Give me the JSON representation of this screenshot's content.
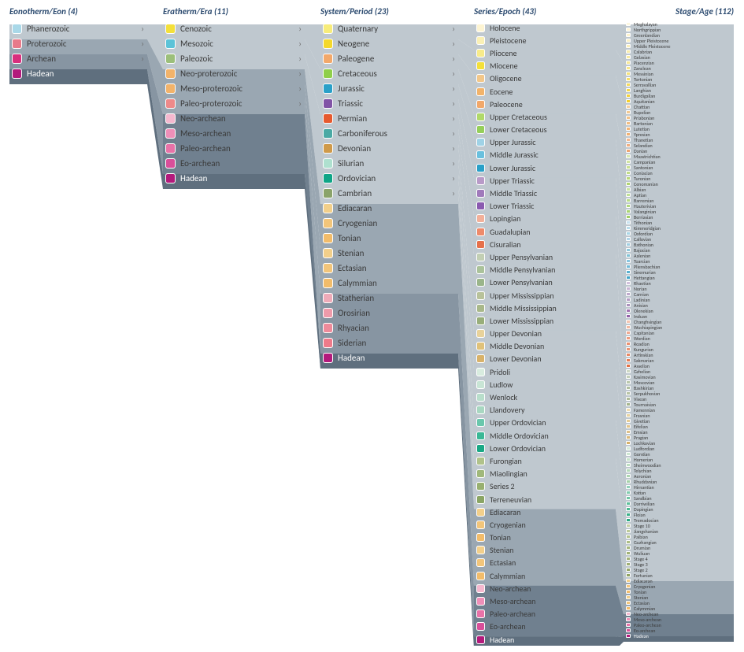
{
  "columns": [
    {
      "header": "Eonotherm/Eon (4)",
      "items": [
        {
          "label": "Phanerozoic",
          "color": "#a9d8e8",
          "expand": true
        },
        {
          "label": "Proterozoic",
          "color": "#e87a8a",
          "expand": true
        },
        {
          "label": "Archean",
          "color": "#d92f7e",
          "expand": true
        },
        {
          "label": "Hadean",
          "color": "#b31a7c",
          "expand": false,
          "selected": true
        }
      ]
    },
    {
      "header": "Eratherm/Era (11)",
      "items": [
        {
          "label": "Cenozoic",
          "color": "#f4e03a",
          "expand": true
        },
        {
          "label": "Mesozoic",
          "color": "#5cc3d8",
          "expand": true
        },
        {
          "label": "Paleozoic",
          "color": "#9cbf7a",
          "expand": true
        },
        {
          "label": "Neo-proterozoic",
          "color": "#f2b36a",
          "expand": true
        },
        {
          "label": "Meso-proterozoic",
          "color": "#f2b36a",
          "expand": true
        },
        {
          "label": "Paleo-proterozoic",
          "color": "#ee8a8a",
          "expand": true
        },
        {
          "label": "Neo-archean",
          "color": "#f4b8cf",
          "expand": false
        },
        {
          "label": "Meso-archean",
          "color": "#ee8fb8",
          "expand": false
        },
        {
          "label": "Paleo-archean",
          "color": "#e872a8",
          "expand": false
        },
        {
          "label": "Eo-archean",
          "color": "#d94f9a",
          "expand": false
        },
        {
          "label": "Hadean",
          "color": "#b31a7c",
          "expand": false,
          "selected": true
        }
      ]
    },
    {
      "header": "System/Period (23)",
      "items": [
        {
          "label": "Quaternary",
          "color": "#f7ec7a",
          "expand": true
        },
        {
          "label": "Neogene",
          "color": "#f4d82a",
          "expand": true
        },
        {
          "label": "Paleogene",
          "color": "#f2a86a",
          "expand": true
        },
        {
          "label": "Cretaceous",
          "color": "#8fcf4a",
          "expand": true
        },
        {
          "label": "Jurassic",
          "color": "#2aa0c8",
          "expand": true
        },
        {
          "label": "Triassic",
          "color": "#8153a6",
          "expand": true
        },
        {
          "label": "Permian",
          "color": "#e65a2f",
          "expand": true
        },
        {
          "label": "Carboniferous",
          "color": "#4aa9a4",
          "expand": true
        },
        {
          "label": "Devonian",
          "color": "#cf9a4a",
          "expand": true
        },
        {
          "label": "Silurian",
          "color": "#aee0cf",
          "expand": true
        },
        {
          "label": "Ordovician",
          "color": "#0fa587",
          "expand": true
        },
        {
          "label": "Cambrian",
          "color": "#8aa36a",
          "expand": true
        },
        {
          "label": "Ediacaran",
          "color": "#f2cf8a",
          "expand": false
        },
        {
          "label": "Cryogenian",
          "color": "#f2c57a",
          "expand": false
        },
        {
          "label": "Tonian",
          "color": "#f2bc6a",
          "expand": false
        },
        {
          "label": "Stenian",
          "color": "#f2cf8a",
          "expand": false
        },
        {
          "label": "Ectasian",
          "color": "#f2c57a",
          "expand": false
        },
        {
          "label": "Calymmian",
          "color": "#f2bc6a",
          "expand": false
        },
        {
          "label": "Statherian",
          "color": "#eeaab8",
          "expand": false
        },
        {
          "label": "Orosirian",
          "color": "#ee9aaa",
          "expand": false
        },
        {
          "label": "Rhyacian",
          "color": "#ee8a9a",
          "expand": false
        },
        {
          "label": "Siderian",
          "color": "#ee7a8a",
          "expand": false
        },
        {
          "label": "Hadean",
          "color": "#b31a7c",
          "expand": false,
          "selected": true
        }
      ]
    },
    {
      "header": "Series/Epoch (43)",
      "items": [
        {
          "label": "Holocene",
          "color": "#fdf4d2"
        },
        {
          "label": "Pleistocene",
          "color": "#faf0b5"
        },
        {
          "label": "Pliocene",
          "color": "#f7eb8a"
        },
        {
          "label": "Miocene",
          "color": "#f4e03a"
        },
        {
          "label": "Oligocene",
          "color": "#f2c78a"
        },
        {
          "label": "Eocene",
          "color": "#f2b36a"
        },
        {
          "label": "Paleocene",
          "color": "#f2a86a"
        },
        {
          "label": "Upper Cretaceous",
          "color": "#b0d96a"
        },
        {
          "label": "Lower Cretaceous",
          "color": "#95cf5a"
        },
        {
          "label": "Upper Jurassic",
          "color": "#9fd2e6"
        },
        {
          "label": "Middle Jurassic",
          "color": "#6ac0de"
        },
        {
          "label": "Lower Jurassic",
          "color": "#2aa0c8"
        },
        {
          "label": "Upper Triassic",
          "color": "#b89ac8"
        },
        {
          "label": "Middle Triassic",
          "color": "#a07abb"
        },
        {
          "label": "Lower Triassic",
          "color": "#8a5ab0"
        },
        {
          "label": "Lopingian",
          "color": "#f2b09a"
        },
        {
          "label": "Guadalupian",
          "color": "#ee8a6a"
        },
        {
          "label": "Cisuralian",
          "color": "#e6704a"
        },
        {
          "label": "Upper Pensylvanian",
          "color": "#c2cfb4"
        },
        {
          "label": "Middle Pensylvanian",
          "color": "#aac29a"
        },
        {
          "label": "Lower Pensylvanian",
          "color": "#9ab58a"
        },
        {
          "label": "Upper Mississippian",
          "color": "#b8c29a"
        },
        {
          "label": "Middle Mississippian",
          "color": "#a8b88a"
        },
        {
          "label": "Lower Mississippian",
          "color": "#98ae7a"
        },
        {
          "label": "Upper Devonian",
          "color": "#e8d29a"
        },
        {
          "label": "Middle Devonian",
          "color": "#e0c27a"
        },
        {
          "label": "Lower Devonian",
          "color": "#d8b26a"
        },
        {
          "label": "Pridoli",
          "color": "#d8ecdf"
        },
        {
          "label": "Ludlow",
          "color": "#c8e5d5"
        },
        {
          "label": "Wenlock",
          "color": "#b8decb"
        },
        {
          "label": "Llandovery",
          "color": "#a8d7c1"
        },
        {
          "label": "Upper Ordovician",
          "color": "#6ac7ac"
        },
        {
          "label": "Middle Ordovician",
          "color": "#3ab896"
        },
        {
          "label": "Lower Ordovician",
          "color": "#1aa885"
        },
        {
          "label": "Furongian",
          "color": "#b0c28a"
        },
        {
          "label": "Miaolingian",
          "color": "#a0b87a"
        },
        {
          "label": "Series 2",
          "color": "#98b070"
        },
        {
          "label": "Terreneuvian",
          "color": "#8aa564"
        },
        {
          "label": "Ediacaran",
          "color": "#f2cf8a"
        },
        {
          "label": "Cryogenian",
          "color": "#f2c57a"
        },
        {
          "label": "Tonian",
          "color": "#f2bc6a"
        },
        {
          "label": "Stenian",
          "color": "#f2cf8a"
        },
        {
          "label": "Ectasian",
          "color": "#f2c57a"
        },
        {
          "label": "Calymmian",
          "color": "#f2bc6a"
        },
        {
          "label": "Neo-archean",
          "color": "#f4b8cf"
        },
        {
          "label": "Meso-archean",
          "color": "#ee8fb8"
        },
        {
          "label": "Paleo-archean",
          "color": "#e872a8"
        },
        {
          "label": "Eo-archean",
          "color": "#d94f9a"
        },
        {
          "label": "Hadean",
          "color": "#b31a7c",
          "selected": true
        }
      ]
    },
    {
      "header": "Stage/Age (112)",
      "items": [
        {
          "label": "Meghalayan",
          "color": "#fdf7e0"
        },
        {
          "label": "Northgrippian",
          "color": "#fdf4d5"
        },
        {
          "label": "Greenlandian",
          "color": "#fdf2cb"
        },
        {
          "label": "Upper Pleistocene",
          "color": "#faf0c5"
        },
        {
          "label": "Middle Pleistocene",
          "color": "#faeeb8"
        },
        {
          "label": "Calabrian",
          "color": "#f8ecab"
        },
        {
          "label": "Gelasian",
          "color": "#f8ea9e"
        },
        {
          "label": "Piacenzian",
          "color": "#f7e895"
        },
        {
          "label": "Zanclean",
          "color": "#f7e68a"
        },
        {
          "label": "Messinian",
          "color": "#f5e27a"
        },
        {
          "label": "Tortonian",
          "color": "#f5de6a"
        },
        {
          "label": "Serravallian",
          "color": "#f5da5a"
        },
        {
          "label": "Langhian",
          "color": "#f4d64a"
        },
        {
          "label": "Burdigalian",
          "color": "#f4d23a"
        },
        {
          "label": "Aquitanian",
          "color": "#f4ce2a"
        },
        {
          "label": "Chattian",
          "color": "#f4d0a0"
        },
        {
          "label": "Rupelian",
          "color": "#f2c890"
        },
        {
          "label": "Priabonian",
          "color": "#f2c288"
        },
        {
          "label": "Bartonian",
          "color": "#f2bc80"
        },
        {
          "label": "Lutetian",
          "color": "#f2b678"
        },
        {
          "label": "Ypresian",
          "color": "#f2b070"
        },
        {
          "label": "Thanetian",
          "color": "#f2b890"
        },
        {
          "label": "Selandian",
          "color": "#f0ae80"
        },
        {
          "label": "Danian",
          "color": "#eea470"
        },
        {
          "label": "Maastrichtian",
          "color": "#d8e8b0"
        },
        {
          "label": "Campanian",
          "color": "#d0e4a0"
        },
        {
          "label": "Santonian",
          "color": "#c8e090"
        },
        {
          "label": "Coniacian",
          "color": "#c0dc86"
        },
        {
          "label": "Turonian",
          "color": "#b8d87a"
        },
        {
          "label": "Cenomanian",
          "color": "#b0d46e"
        },
        {
          "label": "Albian",
          "color": "#c8e4a0"
        },
        {
          "label": "Aptian",
          "color": "#c0e094"
        },
        {
          "label": "Barremian",
          "color": "#b8dc88"
        },
        {
          "label": "Hauterivian",
          "color": "#b0d87c"
        },
        {
          "label": "Valanginian",
          "color": "#a8d470"
        },
        {
          "label": "Berriasian",
          "color": "#a0d064"
        },
        {
          "label": "Tithonian",
          "color": "#c8e2f0"
        },
        {
          "label": "Kimmeridgian",
          "color": "#b8dceb"
        },
        {
          "label": "Oxfordian",
          "color": "#a8d6e6"
        },
        {
          "label": "Callovian",
          "color": "#b0d5e8"
        },
        {
          "label": "Bathonian",
          "color": "#a0cfe2"
        },
        {
          "label": "Bajocian",
          "color": "#90c8dc"
        },
        {
          "label": "Aalenian",
          "color": "#80c2d6"
        },
        {
          "label": "Toarcian",
          "color": "#88c5e0"
        },
        {
          "label": "Pliensbachian",
          "color": "#70bad8"
        },
        {
          "label": "Sinemurian",
          "color": "#58b0d0"
        },
        {
          "label": "Hettangian",
          "color": "#40a5c8"
        },
        {
          "label": "Rhaetian",
          "color": "#d2c0dc"
        },
        {
          "label": "Norian",
          "color": "#c8b4d4"
        },
        {
          "label": "Carnian",
          "color": "#bea8cc"
        },
        {
          "label": "Ladinian",
          "color": "#b49cc4"
        },
        {
          "label": "Anisian",
          "color": "#aa90bc"
        },
        {
          "label": "Olenekian",
          "color": "#a070b0"
        },
        {
          "label": "Induan",
          "color": "#9260a8"
        },
        {
          "label": "Changhsingian",
          "color": "#f4c4b0"
        },
        {
          "label": "Wuchiapingian",
          "color": "#f2b8a0"
        },
        {
          "label": "Capitanian",
          "color": "#f0a890"
        },
        {
          "label": "Wordian",
          "color": "#ee9c80"
        },
        {
          "label": "Roadian",
          "color": "#ec9070"
        },
        {
          "label": "Kungurian",
          "color": "#ea9474"
        },
        {
          "label": "Artinskian",
          "color": "#e88864"
        },
        {
          "label": "Sakmarian",
          "color": "#e67c54"
        },
        {
          "label": "Asselian",
          "color": "#e47044"
        },
        {
          "label": "Gzhelian",
          "color": "#ced8c4"
        },
        {
          "label": "Kasimovian",
          "color": "#c4d0b8"
        },
        {
          "label": "Moscovian",
          "color": "#bac8ac"
        },
        {
          "label": "Bashkirian",
          "color": "#b0c0a0"
        },
        {
          "label": "Serpukhovian",
          "color": "#b8c4a4"
        },
        {
          "label": "Visean",
          "color": "#aebc98"
        },
        {
          "label": "Tournaisian",
          "color": "#a4b48c"
        },
        {
          "label": "Famennian",
          "color": "#eedcb0"
        },
        {
          "label": "Frasnian",
          "color": "#ead4a0"
        },
        {
          "label": "Givetian",
          "color": "#e6cc94"
        },
        {
          "label": "Eifelian",
          "color": "#e2c488"
        },
        {
          "label": "Emsian",
          "color": "#dec088"
        },
        {
          "label": "Pragian",
          "color": "#dab878"
        },
        {
          "label": "Lochkovian",
          "color": "#d6b068"
        },
        {
          "label": "Ludfordian",
          "color": "#d4ead8"
        },
        {
          "label": "Gorstian",
          "color": "#cce6d0"
        },
        {
          "label": "Homerian",
          "color": "#c4e2c8"
        },
        {
          "label": "Sheinwoodian",
          "color": "#bcdec0"
        },
        {
          "label": "Telychian",
          "color": "#b4dab8"
        },
        {
          "label": "Aeronian",
          "color": "#acd6b0"
        },
        {
          "label": "Rhuddanian",
          "color": "#a4d2a8"
        },
        {
          "label": "Hirnantian",
          "color": "#90d2b8"
        },
        {
          "label": "Katian",
          "color": "#80ccae"
        },
        {
          "label": "Sandbian",
          "color": "#70c6a4"
        },
        {
          "label": "Darriwilian",
          "color": "#5cc09a"
        },
        {
          "label": "Dapingian",
          "color": "#4aba90"
        },
        {
          "label": "Floian",
          "color": "#38b088"
        },
        {
          "label": "Tremadocian",
          "color": "#28a880"
        },
        {
          "label": "Stage 10",
          "color": "#c4d0a4"
        },
        {
          "label": "Jiangshanian",
          "color": "#bcca98"
        },
        {
          "label": "Paibian",
          "color": "#b4c48c"
        },
        {
          "label": "Guzhangian",
          "color": "#acbe84"
        },
        {
          "label": "Drumian",
          "color": "#a6b87c"
        },
        {
          "label": "Wuliuan",
          "color": "#a0b274"
        },
        {
          "label": "Stage 4",
          "color": "#a4b47a"
        },
        {
          "label": "Stage 3",
          "color": "#9eae72"
        },
        {
          "label": "Stage 2",
          "color": "#98a86a"
        },
        {
          "label": "Fortunian",
          "color": "#90a260"
        },
        {
          "label": "Ediacaran",
          "color": "#f2cf8a"
        },
        {
          "label": "Cryogenian",
          "color": "#f2c57a"
        },
        {
          "label": "Tonian",
          "color": "#f2bc6a"
        },
        {
          "label": "Stenian",
          "color": "#f2cf8a"
        },
        {
          "label": "Ectasian",
          "color": "#f2c57a"
        },
        {
          "label": "Calymmian",
          "color": "#f2bc6a"
        },
        {
          "label": "Neo-archean",
          "color": "#f4b8cf"
        },
        {
          "label": "Meso-archean",
          "color": "#ee8fb8"
        },
        {
          "label": "Paleo-archean",
          "color": "#e872a8"
        },
        {
          "label": "Eo-archean",
          "color": "#d94f9a"
        },
        {
          "label": "Hadean",
          "color": "#b31a7c",
          "selected": true
        }
      ]
    }
  ],
  "flow_shades": {
    "light": "#bfc8cf",
    "mid": "#9aa7b2",
    "midlo": "#8795a2",
    "dark": "#70808f",
    "sel": "#5f6f7e"
  }
}
